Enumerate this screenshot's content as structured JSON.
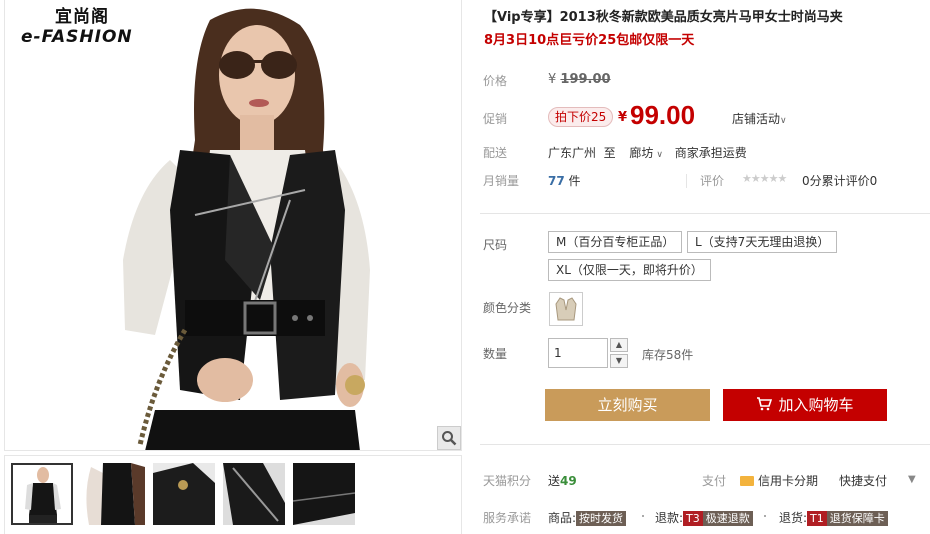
{
  "logo": {
    "text_cn": "宜尚阁",
    "text_en": "e-FASHION"
  },
  "product": {
    "title": "【Vip专享】2013秋冬新款欧美品质女亮片马甲女士时尚马夹",
    "subtitle": "8月3日10点巨亏价25包邮仅限一天"
  },
  "price": {
    "original_label": "价格",
    "original_currency": "¥",
    "original_value": "199.00",
    "promo_label": "促销",
    "promo_badge": "拍下价25",
    "promo_currency": "¥",
    "promo_value": "99.00",
    "shop_activity": "店铺活动"
  },
  "shipping": {
    "label": "配送",
    "from": "广东广州",
    "to_word": "至",
    "to": "廊坊",
    "fee": "商家承担运费"
  },
  "stats": {
    "sales_label": "月销量",
    "sales_count": "77",
    "sales_unit": "件",
    "rating_label": "评价",
    "stars": "★★★★★",
    "rating_text": "0分累计评价0"
  },
  "sku": {
    "size_label": "尺码",
    "sizes": [
      "M（百分百专柜正品）",
      "L（支持7天无理由退换）",
      "XL（仅限一天，即将升价）"
    ],
    "color_label": "颜色分类",
    "qty_label": "数量",
    "qty_value": "1",
    "stock": "库存58件"
  },
  "actions": {
    "buy_now": "立刻购买",
    "add_to_cart": "加入购物车"
  },
  "footer": {
    "points_label": "天猫积分",
    "points_prefix": "送",
    "points_value": "49",
    "pay_label": "支付",
    "credit_card": "信用卡分期",
    "quick_pay": "快捷支付",
    "service_label": "服务承诺",
    "goods_prefix": "商品:",
    "goods_tag": "按时发货",
    "refund_prefix": "退款:",
    "refund_code": "T3",
    "refund_tag": "极速退款",
    "return_prefix": "退货:",
    "return_code": "T1",
    "return_tag": "退货保障卡"
  },
  "colors": {
    "accent_red": "#c40000",
    "buy_button": "#c99b5a",
    "cart_button": "#c40000"
  }
}
